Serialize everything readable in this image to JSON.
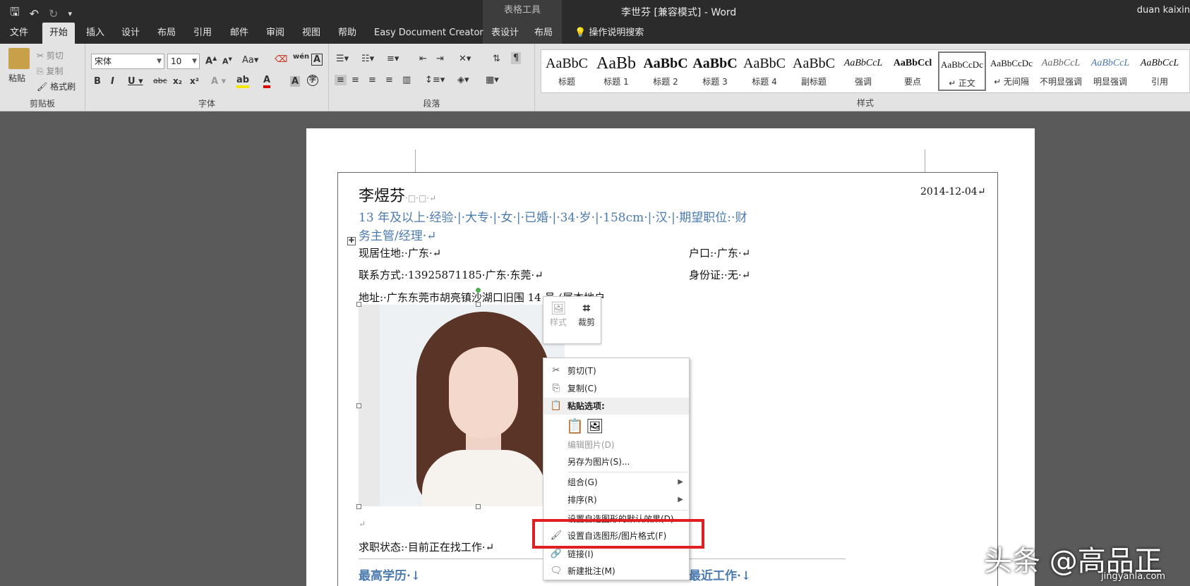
{
  "app": {
    "title": "李世芬 [兼容模式]  -  Word",
    "context_tools": "表格工具",
    "user": "duan kaixin"
  },
  "qat": {
    "save_icon": "save-icon",
    "undo_icon": "undo-icon",
    "redo_icon": "redo-icon",
    "customize_icon": "customize-icon"
  },
  "tabs": [
    "文件",
    "开始",
    "插入",
    "设计",
    "布局",
    "引用",
    "邮件",
    "审阅",
    "视图",
    "帮助",
    "Easy Document Creator",
    "表设计",
    "布局"
  ],
  "tell_me": "操作说明搜索",
  "ribbon": {
    "clipboard": {
      "paste": "粘贴",
      "cut": "剪切",
      "copy": "复制",
      "format_painter": "格式刷",
      "label": "剪贴板"
    },
    "font": {
      "name": "宋体",
      "size": "10",
      "label": "字体"
    },
    "paragraph": {
      "label": "段落"
    },
    "styles": {
      "label": "样式",
      "items": [
        {
          "sample": "AaBbC",
          "name": "标题"
        },
        {
          "sample": "AaBb",
          "name": "标题 1"
        },
        {
          "sample": "AaBbC",
          "name": "标题 2"
        },
        {
          "sample": "AaBbC",
          "name": "标题 3"
        },
        {
          "sample": "AaBbC",
          "name": "标题 4"
        },
        {
          "sample": "AaBbC",
          "name": "副标题"
        },
        {
          "sample": "AaBbCcL",
          "name": "强调"
        },
        {
          "sample": "AaBbCcl",
          "name": "要点"
        },
        {
          "sample": "AaBbCcDc",
          "name": "↵ 正文"
        },
        {
          "sample": "AaBbCcDc",
          "name": "↵ 无间隔"
        },
        {
          "sample": "AaBbCcL",
          "name": "不明显强调"
        },
        {
          "sample": "AaBbCcL",
          "name": "明显强调"
        },
        {
          "sample": "AaBbCcL",
          "name": "引用"
        }
      ]
    }
  },
  "document": {
    "name": "李煜芬",
    "name_marks": "·□·□·↵",
    "date": "2014-12-04↵",
    "summary_line1": "13 年及以上·经验·|·大专·|·女·|·已婚·|·34·岁·|·158cm·|·汉·|·期望职位:·财",
    "summary_line2": "务主管/经理·↵",
    "residence": "现居住地:·广东·↵",
    "hukou": "户口:·广东·↵",
    "contact": "联系方式:·13925871185·广东·东莞·↵",
    "id_card": "身份证:·无·↵",
    "address": "地址:·广东东莞市胡亮镇沙湖口旧围 14 号 (属本地户",
    "empty_para": "↵",
    "job_status": "求职状态:·目前正在找工作·↵",
    "education": "最高学历·↓",
    "recent_work": "最近工作·↓"
  },
  "mini_toolbar": {
    "style": "样式",
    "crop": "裁剪"
  },
  "context_menu": {
    "cut": "剪切(T)",
    "copy": "复制(C)",
    "paste_options": "粘贴选项:",
    "edit_picture": "编辑图片(D)",
    "save_as_picture": "另存为图片(S)...",
    "group": "组合(G)",
    "order": "排序(R)",
    "set_default": "设置自选图形的默认效果(D)",
    "format_picture": "设置自选图形/图片格式(F)",
    "link": "链接(I)",
    "new_comment": "新建批注(M)"
  },
  "watermark": {
    "main": "头条 @高品正",
    "sub": "jingyanla.com"
  },
  "colors": {
    "accent_blue": "#4a7ab0",
    "highlight_red": "#e02020",
    "titlebar": "#2b2b2b",
    "ribbon": "#e3e3e3"
  }
}
